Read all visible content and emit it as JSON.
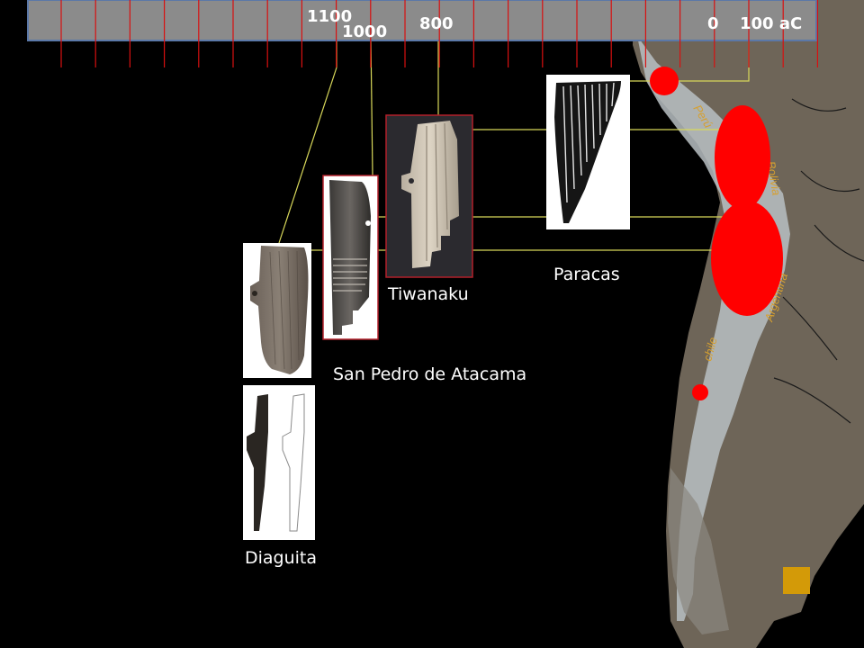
{
  "timeline": {
    "labels": [
      "1100",
      "1000",
      "800",
      "0",
      "100 aC"
    ]
  },
  "artifacts": {
    "paracas": "Paracas",
    "tiwanaku": "Tiwanaku",
    "san_pedro": "San Pedro de Atacama",
    "diaguita": "Diaguita"
  },
  "map": {
    "country_labels": [
      "Perú",
      "Bolivia",
      "Argentina",
      "chile"
    ]
  },
  "colors": {
    "background": "#000000",
    "timeline_fill": "#8b8b8b",
    "timeline_border": "#5b78a8",
    "tick_color": "#d81010",
    "connector": "#d8d85a",
    "site_marker": "#ff0000",
    "map_land": "#6e6558",
    "map_andes": "#b9c0c3",
    "square_marker": "#d39a08"
  }
}
